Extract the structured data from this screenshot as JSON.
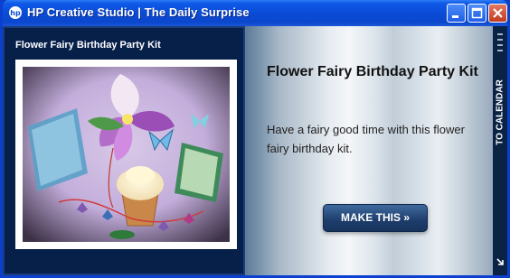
{
  "window": {
    "title": "HP Creative Studio  |  The Daily Surprise",
    "minimize_icon": "minimize-icon",
    "maximize_icon": "maximize-icon",
    "close_icon": "close-icon"
  },
  "left": {
    "title": "Flower Fairy Birthday Party Kit",
    "image_subject": "flower fairy party kit photo"
  },
  "right": {
    "heading": "Flower Fairy Birthday Party Kit",
    "description": "Have a fairy good time with this flower fairy birthday kit.",
    "button_label": "MAKE THIS »"
  },
  "side_tab": {
    "label": "TO CALENDAR",
    "icon": "arrow-icon"
  },
  "colors": {
    "titlebar": "#0a4bd6",
    "panel_dark": "#06204a",
    "button": "#1d3d6b"
  }
}
